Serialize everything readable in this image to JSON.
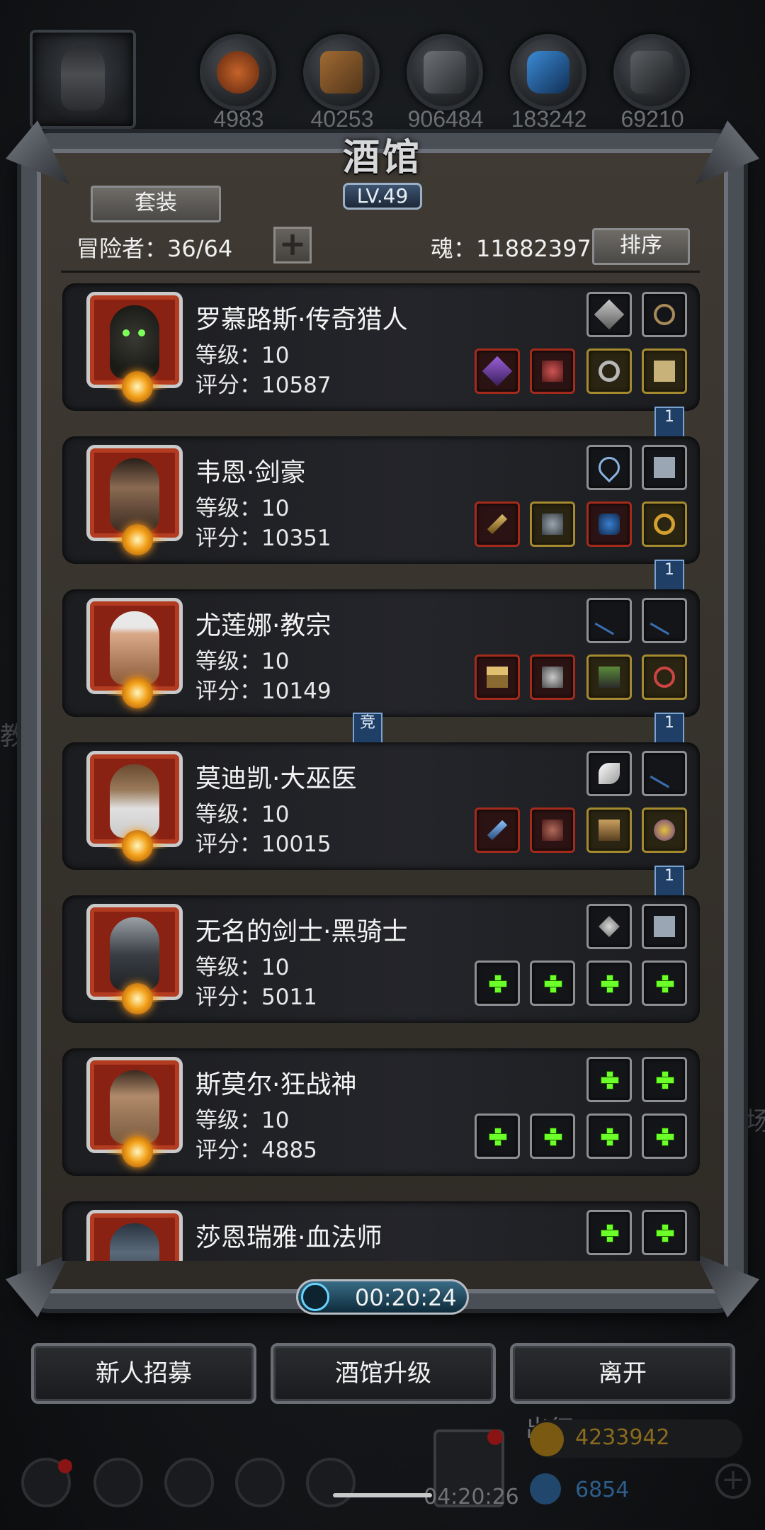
{
  "resources": [
    "4983",
    "40253",
    "906484",
    "183242",
    "69210"
  ],
  "tavern": {
    "title": "酒馆",
    "level": "LV.49",
    "set_button": "套装",
    "adventurers": "冒险者：36/64",
    "souls": "魂：11882397",
    "sort_button": "排序",
    "timer": "00:20:24"
  },
  "heroes": [
    {
      "name": "罗慕路斯·传奇猎人",
      "level": "等级：10",
      "score": "评分：10587"
    },
    {
      "name": "韦恩·剑豪",
      "level": "等级：10",
      "score": "评分：10351"
    },
    {
      "name": "尤莲娜·教宗",
      "level": "等级：10",
      "score": "评分：10149"
    },
    {
      "name": "莫迪凯·大巫医",
      "level": "等级：10",
      "score": "评分：10015"
    },
    {
      "name": "无名的剑士·黑骑士",
      "level": "等级：10",
      "score": "评分：5011"
    },
    {
      "name": "斯莫尔·狂战神",
      "level": "等级：10",
      "score": "评分：4885"
    },
    {
      "name": "莎恩瑞雅·血法师",
      "level": "",
      "score": ""
    }
  ],
  "flags": {
    "rank": "1",
    "compete": "竞"
  },
  "actions": {
    "recruit": "新人招募",
    "upgrade": "酒馆升级",
    "leave": "离开"
  },
  "background": {
    "left_text": "教",
    "right_text": "场",
    "expedition": "出征",
    "gold": "4233942",
    "gems": "6854",
    "countdown": "04:20:26"
  },
  "colors": {
    "accent_green": "#6cff2a",
    "gold": "#b58a1a",
    "frame": "#4a4e55"
  }
}
